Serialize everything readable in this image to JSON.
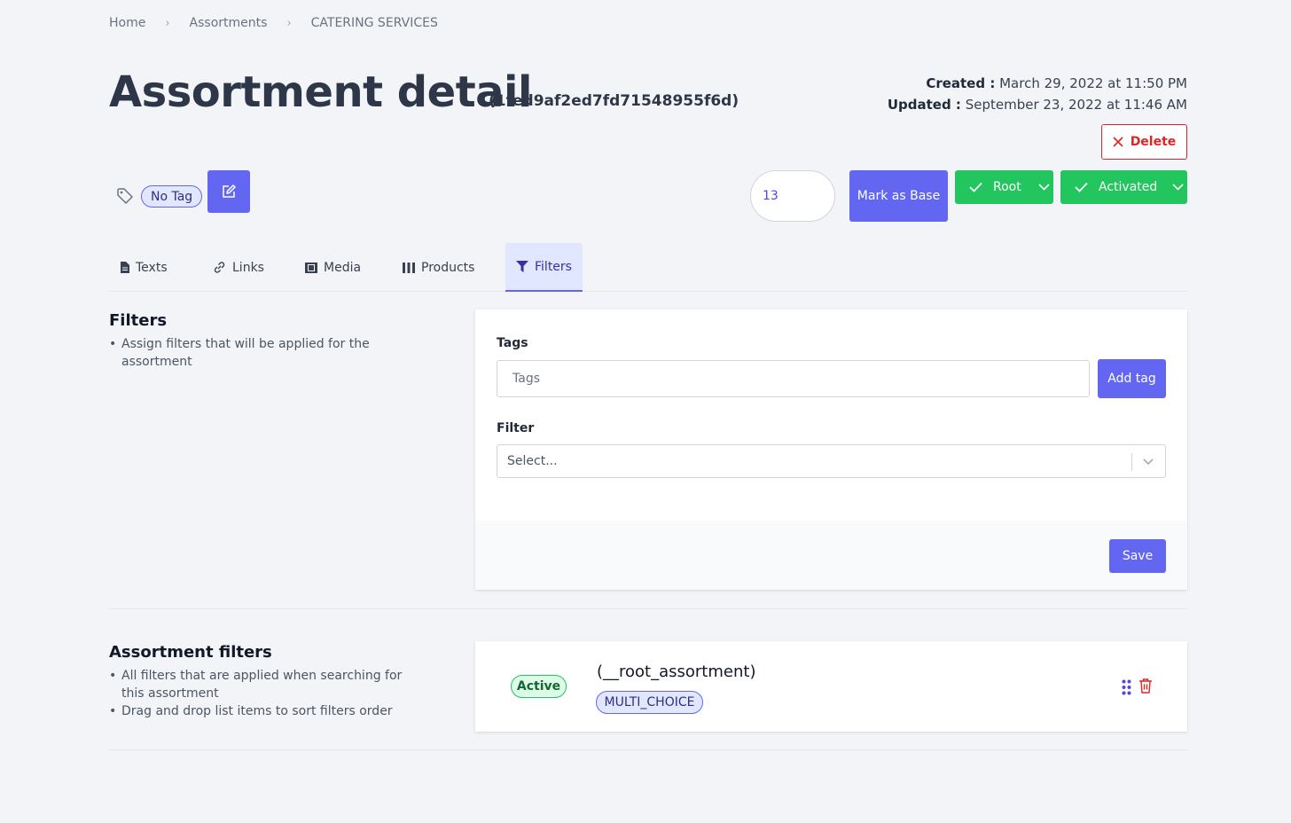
{
  "breadcrumb": {
    "home": "Home",
    "assortments": "Assortments",
    "current": "CATERING SERVICES"
  },
  "header": {
    "title": "Assortment detail",
    "id": "(1fed9af2ed7fd71548955f6d)",
    "created_label": "Created :",
    "created_value": "March 29, 2022 at 11:50 PM",
    "updated_label": "Updated :",
    "updated_value": "September 23, 2022 at 11:46 AM",
    "delete_label": "Delete"
  },
  "toolbar": {
    "tag_label": "No Tag",
    "sequence_value": "13",
    "mark_base_label": "Mark as Base",
    "root_label": "Root",
    "activated_label": "Activated"
  },
  "tabs": [
    {
      "label": "Texts",
      "icon": "document-icon"
    },
    {
      "label": "Links",
      "icon": "link-icon"
    },
    {
      "label": "Media",
      "icon": "film-icon"
    },
    {
      "label": "Products",
      "icon": "columns-icon"
    },
    {
      "label": "Filters",
      "icon": "funnel-icon",
      "active": true
    }
  ],
  "filters_section": {
    "title": "Filters",
    "description": "Assign filters that will be applied for the assortment",
    "tags_label": "Tags",
    "tags_placeholder": "Tags",
    "add_tag_label": "Add tag",
    "filter_label": "Filter",
    "filter_placeholder": "Select...",
    "save_label": "Save"
  },
  "assortment_filters": {
    "title": "Assortment filters",
    "desc_1": "All filters that are applied when searching for this assortment",
    "desc_2": "Drag and drop list items to sort filters order",
    "items": [
      {
        "status": "Active",
        "name": "(__root_assortment)",
        "type": "MULTI_CHOICE"
      }
    ]
  },
  "colors": {
    "primary": "#6366f1",
    "success": "#22c55e",
    "danger": "#dc2626"
  }
}
